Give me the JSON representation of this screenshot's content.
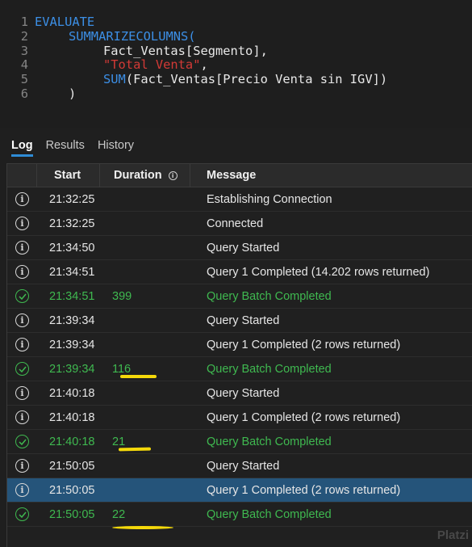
{
  "editor": {
    "lines": [
      {
        "n": "1",
        "parts": [
          "EVALUATE"
        ]
      },
      {
        "n": "2",
        "parts": [
          "SUMMARIZECOLUMNS("
        ]
      },
      {
        "n": "3",
        "parts": [
          "Fact_Ventas[Segmento],"
        ]
      },
      {
        "n": "4",
        "parts": [
          "\"Total Venta\"",
          ","
        ]
      },
      {
        "n": "5",
        "parts": [
          "SUM",
          "(Fact_Ventas[Precio Venta sin IGV])"
        ]
      },
      {
        "n": "6",
        "parts": [
          ")"
        ]
      }
    ]
  },
  "tabs": [
    {
      "label": "Log",
      "active": true
    },
    {
      "label": "Results",
      "active": false
    },
    {
      "label": "History",
      "active": false
    }
  ],
  "table": {
    "headers": {
      "start": "Start",
      "duration": "Duration",
      "message": "Message"
    },
    "rows": [
      {
        "type": "info",
        "start": "21:32:25",
        "duration": "",
        "message": "Establishing Connection"
      },
      {
        "type": "info",
        "start": "21:32:25",
        "duration": "",
        "message": "Connected"
      },
      {
        "type": "info",
        "start": "21:34:50",
        "duration": "",
        "message": "Query Started"
      },
      {
        "type": "info",
        "start": "21:34:51",
        "duration": "",
        "message": "Query 1 Completed (14.202 rows returned)"
      },
      {
        "type": "success",
        "start": "21:34:51",
        "duration": "399",
        "message": "Query Batch Completed"
      },
      {
        "type": "info",
        "start": "21:39:34",
        "duration": "",
        "message": "Query Started"
      },
      {
        "type": "info",
        "start": "21:39:34",
        "duration": "",
        "message": "Query 1 Completed (2 rows returned)"
      },
      {
        "type": "success",
        "start": "21:39:34",
        "duration": "116",
        "message": "Query Batch Completed"
      },
      {
        "type": "info",
        "start": "21:40:18",
        "duration": "",
        "message": "Query Started"
      },
      {
        "type": "info",
        "start": "21:40:18",
        "duration": "",
        "message": "Query 1 Completed (2 rows returned)"
      },
      {
        "type": "success",
        "start": "21:40:18",
        "duration": "21",
        "message": "Query Batch Completed"
      },
      {
        "type": "info",
        "start": "21:50:05",
        "duration": "",
        "message": "Query Started"
      },
      {
        "type": "info",
        "start": "21:50:05",
        "duration": "",
        "message": "Query 1 Completed (2 rows returned)",
        "selected": true
      },
      {
        "type": "success",
        "start": "21:50:05",
        "duration": "22",
        "message": "Query Batch Completed"
      }
    ]
  },
  "icons": {
    "info": "info-circle-icon",
    "success": "check-circle-icon"
  },
  "colors": {
    "success": "#3fb950",
    "selected": "#25547a",
    "keyword": "#3c8fe6",
    "string": "#d33a36",
    "highlight": "#f5d90a"
  },
  "watermark": "Platzi"
}
